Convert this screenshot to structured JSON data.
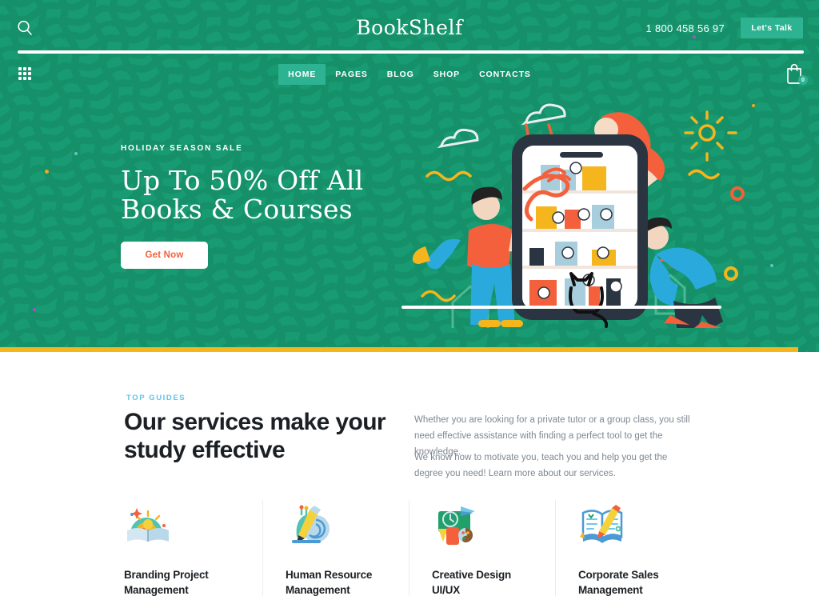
{
  "header": {
    "logo": "BookShelf",
    "phone": "1 800 458 56 97",
    "cta_label": "Let's Talk",
    "search_icon": "search-icon",
    "grid_icon": "grid-menu-icon",
    "cart_icon": "shopping-bag-icon",
    "cart_count": "0"
  },
  "nav": {
    "items": [
      {
        "label": "HOME",
        "active": true
      },
      {
        "label": "PAGES",
        "active": false
      },
      {
        "label": "BLOG",
        "active": false
      },
      {
        "label": "SHOP",
        "active": false
      },
      {
        "label": "CONTACTS",
        "active": false
      }
    ]
  },
  "hero": {
    "eyebrow": "HOLIDAY SEASON SALE",
    "title": "Up To 50% Off All\nBooks & Courses",
    "button_label": "Get Now",
    "background_color": "#189b72",
    "accent_bar_color": "#f5b51c",
    "button_text_color": "#f4603b"
  },
  "services": {
    "eyebrow": "TOP GUIDES",
    "eyebrow_color": "#61c3e8",
    "title": "Our services make your\nstudy effective",
    "paragraph_1": "Whether you are looking for a private tutor or a group class, you still need effective assistance with finding a perfect tool to get the knowledge.",
    "paragraph_2": "We know how to motivate you, teach you and help you get the degree you need! Learn more about our services.",
    "cards": [
      {
        "label": "Branding Project\nManagement",
        "icon": "rainbow-lightbulb-book-icon"
      },
      {
        "label": "Human Resource\nManagement",
        "icon": "pencil-snail-icon"
      },
      {
        "label": "Creative Design\nUI/UX",
        "icon": "chalkboard-palette-icon"
      },
      {
        "label": "Corporate Sales\nManagement",
        "icon": "open-book-pencil-icon"
      }
    ]
  }
}
